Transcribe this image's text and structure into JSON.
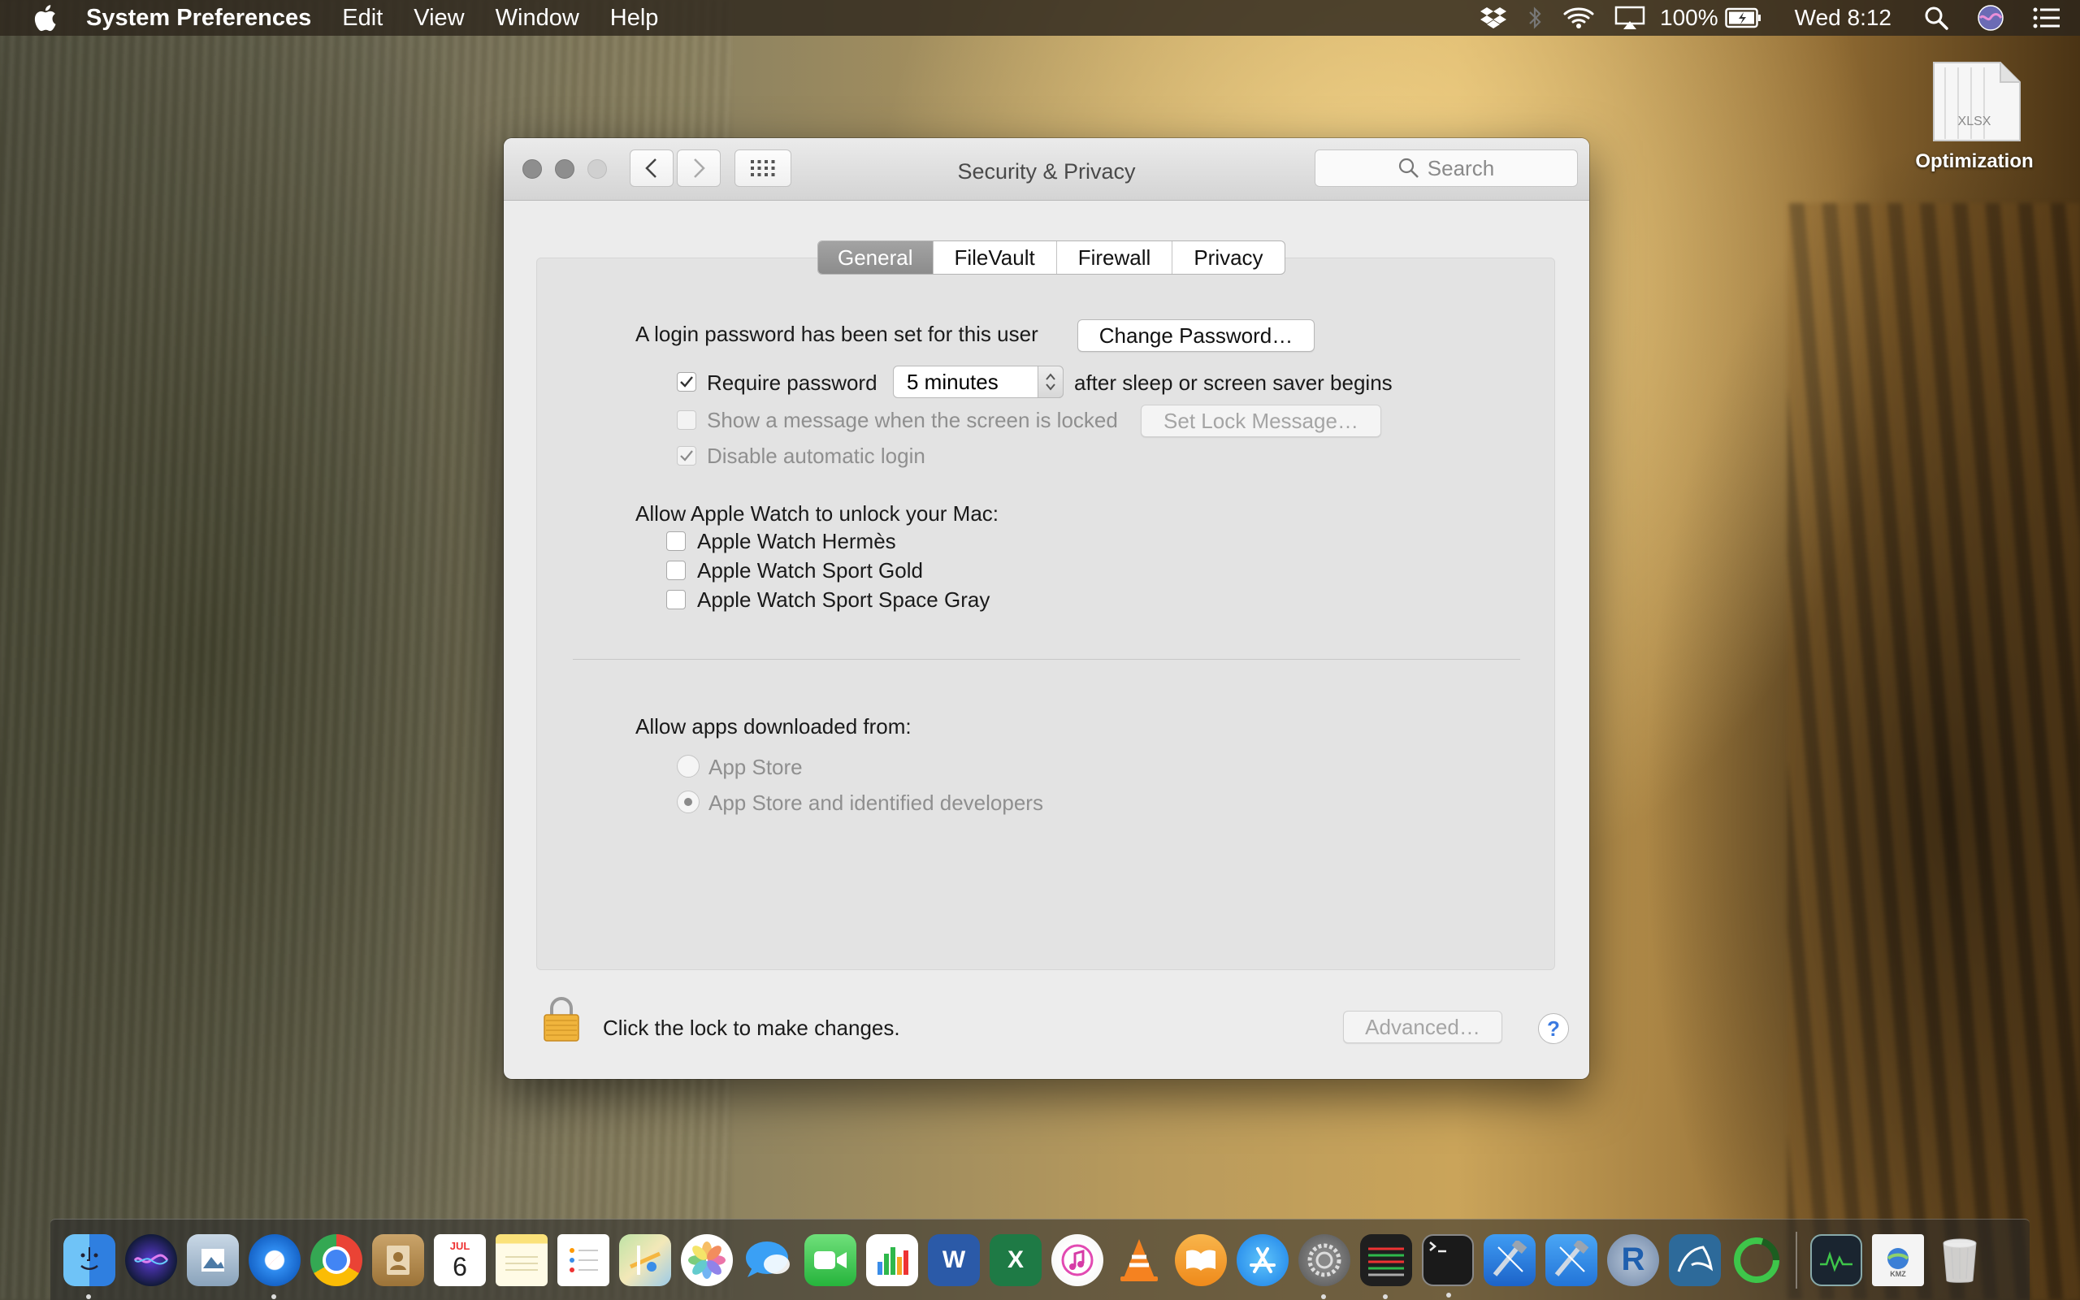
{
  "menubar": {
    "app_name": "System Preferences",
    "menus": [
      "Edit",
      "View",
      "Window",
      "Help"
    ],
    "battery": "100%",
    "clock": "Wed 8:12"
  },
  "desktop": {
    "file_name": "Optimization",
    "file_type": "XLSX"
  },
  "window": {
    "title": "Security & Privacy",
    "search_placeholder": "Search",
    "tabs": [
      "General",
      "FileVault",
      "Firewall",
      "Privacy"
    ],
    "active_tab": "General",
    "general": {
      "login_text": "A login password has been set for this user",
      "change_password_label": "Change Password…",
      "require_password_label": "Require password",
      "require_password_checked": true,
      "require_password_delay": "5 minutes",
      "after_sleep_text": "after sleep or screen saver begins",
      "show_message_label": "Show a message when the screen is locked",
      "show_message_checked": false,
      "set_lock_message_label": "Set Lock Message…",
      "disable_auto_login_label": "Disable automatic login",
      "disable_auto_login_checked": true,
      "apple_watch_heading": "Allow Apple Watch to unlock your Mac:",
      "apple_watches": [
        "Apple Watch Hermès",
        "Apple Watch Sport Gold",
        "Apple Watch Sport Space Gray"
      ],
      "allow_apps_heading": "Allow apps downloaded from:",
      "app_sources": [
        "App Store",
        "App Store and identified developers"
      ],
      "app_source_selected": "App Store and identified developers"
    },
    "footer": {
      "lock_text": "Click the lock to make changes.",
      "advanced_label": "Advanced…",
      "help_label": "?"
    }
  },
  "dock": {
    "icons": [
      "finder-icon",
      "siri-icon",
      "preview-icon",
      "safari-icon",
      "chrome-icon",
      "contacts-icon",
      "calendar-icon",
      "notes-icon",
      "reminders-icon",
      "maps-icon",
      "photos-icon",
      "messages-icon",
      "facetime-icon",
      "numbers-icon",
      "word-icon",
      "excel-icon",
      "itunes-icon",
      "vlc-icon",
      "ibooks-icon",
      "app-store-icon",
      "system-preferences-icon",
      "istat-icon",
      "terminal-icon",
      "xcode-beta-icon",
      "xcode-icon",
      "r-icon",
      "mysql-workbench-icon",
      "activity-ring-icon",
      "activity-monitor-icon",
      "google-earth-file-icon",
      "trash-icon"
    ],
    "calendar_month": "JUL",
    "calendar_day": "6"
  },
  "colors": {
    "accent": "#3b7ae0",
    "tab_active": "#979797"
  }
}
